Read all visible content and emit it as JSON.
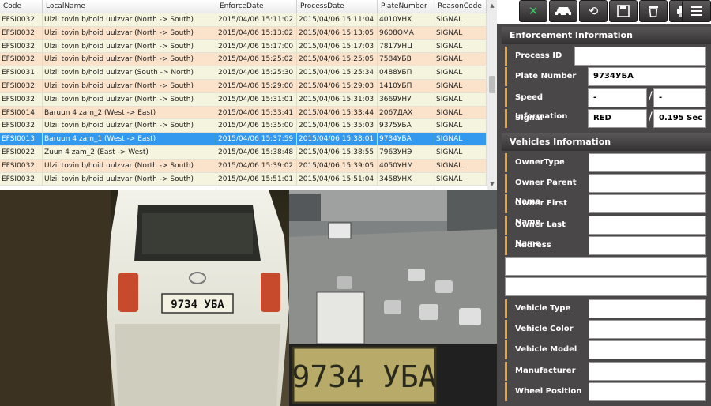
{
  "grid": {
    "headers": [
      "Code",
      "LocalName",
      "EnforceDate",
      "ProcessDate",
      "PlateNumber",
      "ReasonCode"
    ],
    "rows": [
      [
        "EFSI0032",
        "Ulzii tovin b/hoid uulzvar (North -> South)",
        "2015/04/06 15:11:02",
        "2015/04/06 15:11:04",
        "4010УНХ",
        "SIGNAL"
      ],
      [
        "EFSI0032",
        "Ulzii tovin b/hoid uulzvar (North -> South)",
        "2015/04/06 15:13:02",
        "2015/04/06 15:13:05",
        "9608ӨМА",
        "SIGNAL"
      ],
      [
        "EFSI0032",
        "Ulzii tovin b/hoid uulzvar (North -> South)",
        "2015/04/06 15:17:00",
        "2015/04/06 15:17:03",
        "7817УНЦ",
        "SIGNAL"
      ],
      [
        "EFSI0032",
        "Ulzii tovin b/hoid uulzvar (North -> South)",
        "2015/04/06 15:25:02",
        "2015/04/06 15:25:05",
        "7584УБВ",
        "SIGNAL"
      ],
      [
        "EFSI0031",
        "Ulzii tovin b/hoid uulzvar (South -> North)",
        "2015/04/06 15:25:30",
        "2015/04/06 15:25:34",
        "0488УБП",
        "SIGNAL"
      ],
      [
        "EFSI0032",
        "Ulzii tovin b/hoid uulzvar (North -> South)",
        "2015/04/06 15:29:00",
        "2015/04/06 15:29:03",
        "1410УБП",
        "SIGNAL"
      ],
      [
        "EFSI0032",
        "Ulzii tovin b/hoid uulzvar (North -> South)",
        "2015/04/06 15:31:01",
        "2015/04/06 15:31:03",
        "3669УНУ",
        "SIGNAL"
      ],
      [
        "EFSI0014",
        "Baruun 4 zam_2 (West -> East)",
        "2015/04/06 15:33:41",
        "2015/04/06 15:33:44",
        "2067ДАХ",
        "SIGNAL"
      ],
      [
        "EFSI0032",
        "Ulzii tovin b/hoid uulzvar (North -> South)",
        "2015/04/06 15:35:00",
        "2015/04/06 15:35:03",
        "9375УБА",
        "SIGNAL"
      ],
      [
        "EFSI0013",
        "Baruun 4 zam_1 (West -> East)",
        "2015/04/06 15:37:59",
        "2015/04/06 15:38:01",
        "9734УБА",
        "SIGNAL"
      ],
      [
        "EFSI0022",
        "Zuun 4 zam_2 (East -> West)",
        "2015/04/06 15:38:48",
        "2015/04/06 15:38:55",
        "7963УНЭ",
        "SIGNAL"
      ],
      [
        "EFSI0032",
        "Ulzii tovin b/hoid uulzvar (North -> South)",
        "2015/04/06 15:39:02",
        "2015/04/06 15:39:05",
        "4050УНМ",
        "SIGNAL"
      ],
      [
        "EFSI0032",
        "Ulzii tovin b/hoid uulzvar (North -> South)",
        "2015/04/06 15:51:01",
        "2015/04/06 15:51:04",
        "3458УНХ",
        "SIGNAL"
      ]
    ],
    "selected_index": 9
  },
  "images": {
    "close_plate_text": "9734 УБА",
    "zoom_plate_text": "9734 УБА"
  },
  "toolbar": {
    "icons": [
      "excel-icon",
      "car-icon",
      "refresh-icon",
      "save-icon",
      "trash-icon",
      "printer-icon",
      "list-icon"
    ]
  },
  "enforcement": {
    "title": "Enforcement Information",
    "process_id_label": "Process ID",
    "process_id_value": "",
    "plate_label": "Plate Number",
    "plate_value": "9734УБА",
    "speed_label": "Speed Information",
    "speed_value_1": "-",
    "speed_value_2": "-",
    "signal_label": "Signal Information",
    "signal_value_1": "RED",
    "signal_value_2": "0.195 Sec"
  },
  "vehicles": {
    "title": "Vehicles Information",
    "owner_type_label": "OwnerType",
    "owner_parent_label": "Owner Parent Name",
    "owner_first_label": "Owner First Name",
    "owner_last_label": "Owner Last Name",
    "address_label": "Address",
    "vehicle_type_label": "Vehicle Type",
    "vehicle_color_label": "Vehicle Color",
    "vehicle_model_label": "Vehicle Model",
    "manufacturer_label": "Manufacturer",
    "wheel_position_label": "Wheel Position"
  },
  "colors": {
    "selected_row": "#3399ee",
    "row_odd": "#f5f4de",
    "row_even": "#fbe3cb",
    "panel_bg": "#4a4748",
    "label_accent": "#f0a030"
  }
}
